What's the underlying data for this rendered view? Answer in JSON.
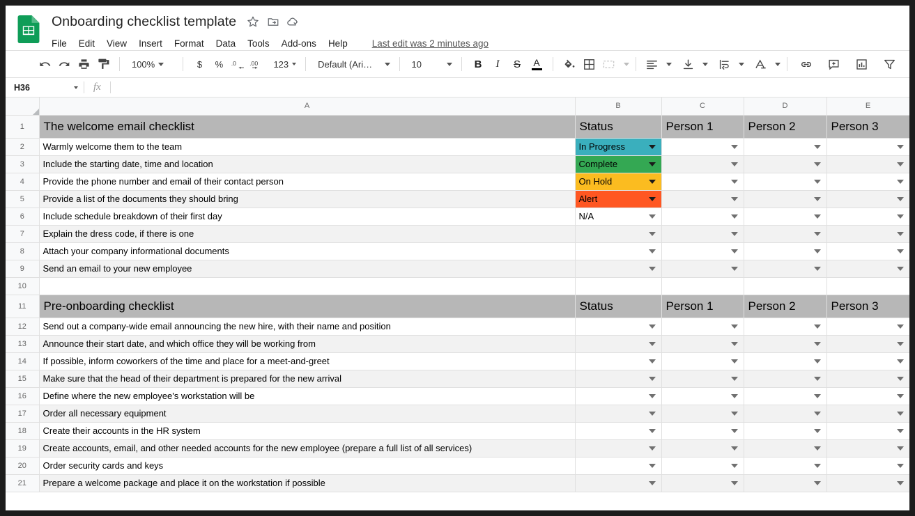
{
  "app": {
    "doc_title": "Onboarding checklist template",
    "doc_icon": "sheets-icon",
    "title_icons": [
      "star-icon",
      "move-to-folder-icon",
      "cloud-saved-icon"
    ],
    "menus": [
      "File",
      "Edit",
      "View",
      "Insert",
      "Format",
      "Data",
      "Tools",
      "Add-ons",
      "Help"
    ],
    "last_edit": "Last edit was 2 minutes ago"
  },
  "toolbar": {
    "undo": "undo-icon",
    "redo": "redo-icon",
    "print": "print-icon",
    "paint_format": "paint-format-icon",
    "zoom_value": "100%",
    "currency": "$",
    "percent": "%",
    "decrease_decimal": ".0",
    "increase_decimal": ".00",
    "more_formats": "123",
    "font_value": "Default (Ari…",
    "size_value": "10",
    "bold": "B",
    "italic": "I",
    "strikethrough": "S",
    "text_color": "A",
    "fill_color": "fill-color-icon",
    "borders": "borders-icon",
    "merge_cells": "merge-cells-icon",
    "halign": "horizontal-align-icon",
    "valign": "vertical-align-icon",
    "text_wrap": "text-wrapping-icon",
    "text_rotate": "text-rotation-icon",
    "link": "insert-link-icon",
    "comment": "insert-comment-icon",
    "chart": "insert-chart-icon",
    "filter": "create-filter-icon"
  },
  "formula_bar": {
    "name_box": "H36",
    "fx_symbol": "fx",
    "formula_value": ""
  },
  "sheet": {
    "columns": [
      "A",
      "B",
      "C",
      "D",
      "E"
    ],
    "rows": [
      {
        "n": "1",
        "type": "section",
        "band": "plain",
        "a": "The welcome email checklist",
        "b": "Status",
        "c": "Person 1",
        "d": "Person 2",
        "e": "Person 3"
      },
      {
        "n": "2",
        "type": "data",
        "band": "plain",
        "a": "Warmly welcome them to the team",
        "b": "In Progress",
        "b_style": "st-inprogress"
      },
      {
        "n": "3",
        "type": "data",
        "band": "banded",
        "a": "Include the starting date, time and location",
        "b": "Complete",
        "b_style": "st-complete"
      },
      {
        "n": "4",
        "type": "data",
        "band": "plain",
        "a": "Provide the phone number and email of their contact person",
        "b": "On Hold",
        "b_style": "st-onhold"
      },
      {
        "n": "5",
        "type": "data",
        "band": "banded",
        "a": "Provide a list of the documents they should bring",
        "b": "Alert",
        "b_style": "st-alert"
      },
      {
        "n": "6",
        "type": "data",
        "band": "plain",
        "a": "Include schedule breakdown of their first day",
        "b": "N/A",
        "b_style": ""
      },
      {
        "n": "7",
        "type": "data",
        "band": "banded",
        "a": "Explain the dress code, if there is one",
        "b": "",
        "b_style": ""
      },
      {
        "n": "8",
        "type": "data",
        "band": "plain",
        "a": "Attach your company informational documents",
        "b": "",
        "b_style": ""
      },
      {
        "n": "9",
        "type": "data",
        "band": "banded",
        "a": "Send an email to your new employee",
        "b": "",
        "b_style": ""
      },
      {
        "n": "10",
        "type": "empty",
        "band": "plain",
        "a": "",
        "b": "",
        "b_style": ""
      },
      {
        "n": "11",
        "type": "section",
        "band": "plain",
        "a": "Pre-onboarding checklist",
        "b": "Status",
        "c": "Person 1",
        "d": "Person 2",
        "e": "Person 3"
      },
      {
        "n": "12",
        "type": "data",
        "band": "plain",
        "a": "Send out a company-wide email announcing the new hire, with their name and position",
        "b": "",
        "b_style": ""
      },
      {
        "n": "13",
        "type": "data",
        "band": "banded",
        "a": "Announce their start date, and which office they will be working from",
        "b": "",
        "b_style": ""
      },
      {
        "n": "14",
        "type": "data",
        "band": "plain",
        "a": "If possible, inform coworkers of the time and place for a meet-and-greet",
        "b": "",
        "b_style": ""
      },
      {
        "n": "15",
        "type": "data",
        "band": "banded",
        "a": "Make sure that the head of their department is prepared for the new arrival",
        "b": "",
        "b_style": ""
      },
      {
        "n": "16",
        "type": "data",
        "band": "plain",
        "a": "Define where the new employee's workstation will be",
        "b": "",
        "b_style": ""
      },
      {
        "n": "17",
        "type": "data",
        "band": "banded",
        "a": "Order all necessary equipment",
        "b": "",
        "b_style": ""
      },
      {
        "n": "18",
        "type": "data",
        "band": "plain",
        "a": "Create their accounts in the HR system",
        "b": "",
        "b_style": ""
      },
      {
        "n": "19",
        "type": "data",
        "band": "banded",
        "a": "Create accounts, email, and other needed accounts for the new employee (prepare a full list of all services)",
        "b": "",
        "b_style": ""
      },
      {
        "n": "20",
        "type": "data",
        "band": "plain",
        "a": "Order security cards and keys",
        "b": "",
        "b_style": ""
      },
      {
        "n": "21",
        "type": "data",
        "band": "banded",
        "a": "Prepare a welcome package and place it on the workstation if possible",
        "b": "",
        "b_style": ""
      }
    ]
  },
  "colors": {
    "brand_green": "#0f9d58",
    "section_header_bg": "#b7b7b7",
    "status_in_progress": "#3aafbd",
    "status_complete": "#34a853",
    "status_on_hold": "#fbbc20",
    "status_alert": "#ff5722"
  }
}
